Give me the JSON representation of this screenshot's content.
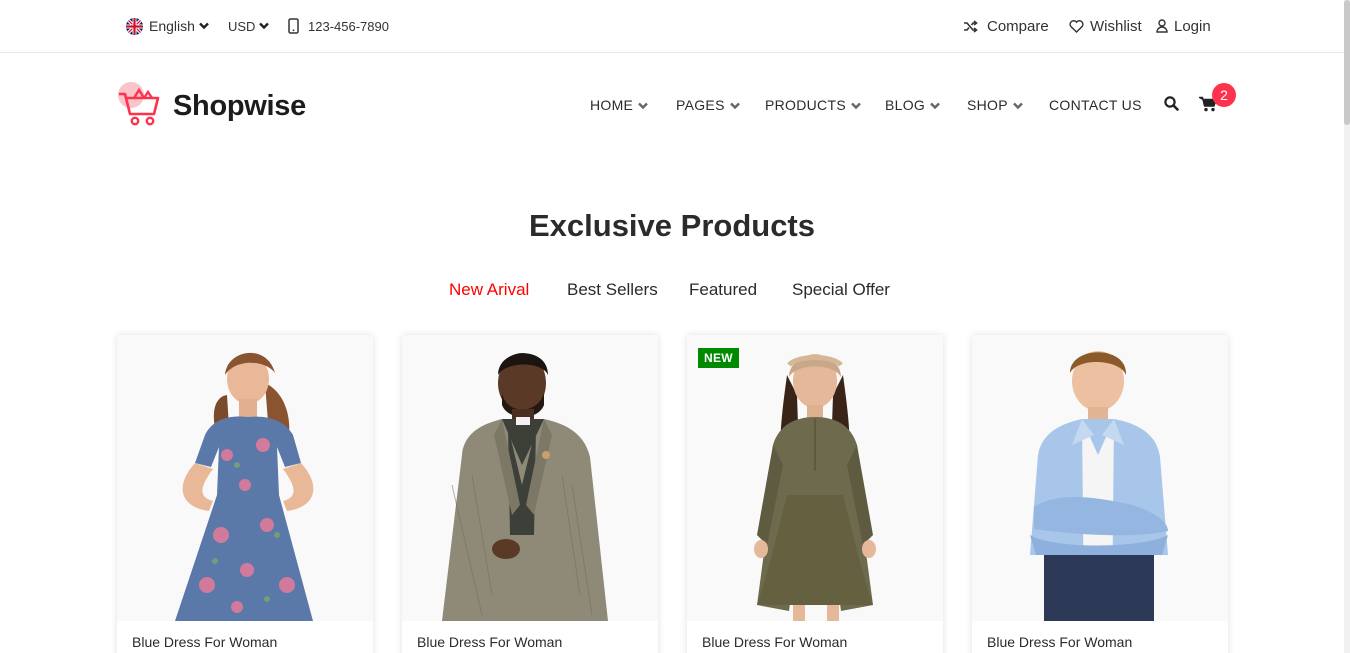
{
  "topbar": {
    "language": "English",
    "currency": "USD",
    "phone": "123-456-7890",
    "compare": "Compare",
    "wishlist": "Wishlist",
    "login": "Login"
  },
  "brand": {
    "name": "Shopwise",
    "accent": "#ff324d"
  },
  "nav": {
    "items": [
      "HOME",
      "PAGES",
      "PRODUCTS",
      "BLOG",
      "SHOP",
      "CONTACT US"
    ],
    "cart_count": "2"
  },
  "section": {
    "title": "Exclusive Products",
    "tabs": [
      "New Arival",
      "Best Sellers",
      "Featured",
      "Special Offer"
    ],
    "active_tab": "New Arival",
    "active_color": "#ff0000"
  },
  "products": [
    {
      "name": "Blue Dress For Woman",
      "badge": ""
    },
    {
      "name": "Blue Dress For Woman",
      "badge": ""
    },
    {
      "name": "Blue Dress For Woman",
      "badge": "NEW"
    },
    {
      "name": "Blue Dress For Woman",
      "badge": ""
    }
  ],
  "icons": {
    "language": "uk-flag-icon",
    "phone": "mobile-phone-icon",
    "compare": "shuffle-icon",
    "wishlist": "heart-icon",
    "login": "user-icon",
    "search": "search-icon",
    "cart": "cart-icon",
    "logo": "shopping-cart-logo-icon"
  }
}
